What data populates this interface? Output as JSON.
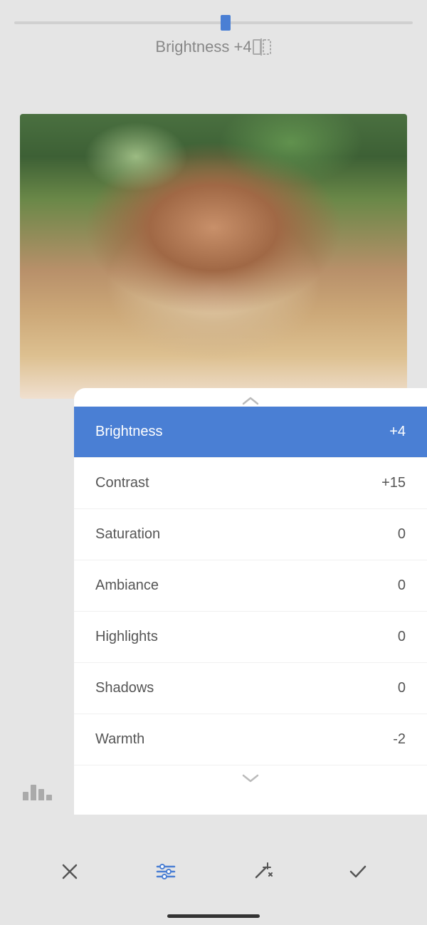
{
  "slider": {
    "label": "Brightness +4",
    "value": 4,
    "percent": 53
  },
  "compare_icon": "⊡",
  "list_items": [
    {
      "id": "brightness",
      "label": "Brightness",
      "value": "+4",
      "active": true
    },
    {
      "id": "contrast",
      "label": "Contrast",
      "value": "+15",
      "active": false
    },
    {
      "id": "saturation",
      "label": "Saturation",
      "value": "0",
      "active": false
    },
    {
      "id": "ambiance",
      "label": "Ambiance",
      "value": "0",
      "active": false
    },
    {
      "id": "highlights",
      "label": "Highlights",
      "value": "0",
      "active": false
    },
    {
      "id": "shadows",
      "label": "Shadows",
      "value": "0",
      "active": false
    },
    {
      "id": "warmth",
      "label": "Warmth",
      "value": "-2",
      "active": false
    }
  ],
  "toolbar": {
    "cancel_label": "×",
    "filters_label": "filters",
    "auto_label": "auto",
    "confirm_label": "✓"
  },
  "colors": {
    "accent": "#4a7fd4",
    "text_secondary": "#888",
    "background": "#e5e5e5"
  }
}
